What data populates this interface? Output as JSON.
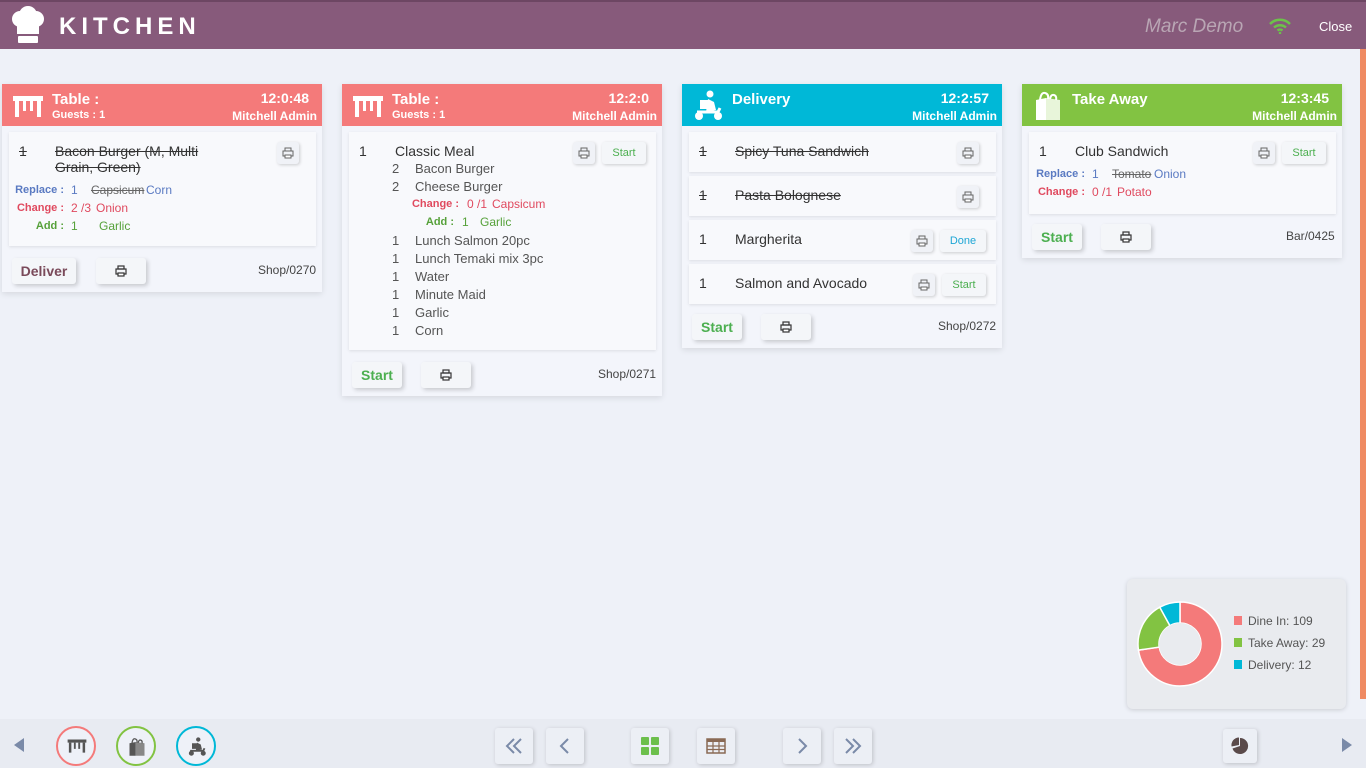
{
  "app": {
    "title": "KITCHEN",
    "user": "Marc Demo",
    "close_label": "Close"
  },
  "orders": [
    {
      "type": "Table :",
      "sub": "Guests : 1",
      "time": "12:0:48",
      "admin": "Mitchell Admin",
      "items": [
        {
          "qty": "1",
          "name": "Bacon Burger (M, Multi Grain, Green)",
          "done": true
        }
      ],
      "modifiers": [
        {
          "label": "Replace :",
          "qty": "1",
          "old": "Capsicum",
          "new": "Corn"
        },
        {
          "label": "Change :",
          "qty": "2 /3",
          "new": "Onion"
        },
        {
          "label": "Add :",
          "qty": "1",
          "new": "Garlic"
        }
      ],
      "action": "Deliver",
      "ref": "Shop/0270"
    },
    {
      "type": "Table :",
      "sub": "Guests : 1",
      "time": "12:2:0",
      "admin": "Mitchell Admin",
      "items": [
        {
          "qty": "1",
          "name": "Classic Meal",
          "button": "Start"
        }
      ],
      "sub_items": [
        {
          "qty": "2",
          "name": "Bacon Burger"
        },
        {
          "qty": "2",
          "name": "Cheese Burger"
        },
        {
          "qty": "1",
          "name": "Lunch Salmon 20pc"
        },
        {
          "qty": "1",
          "name": "Lunch Temaki mix 3pc"
        },
        {
          "qty": "1",
          "name": "Water"
        },
        {
          "qty": "1",
          "name": "Minute Maid"
        },
        {
          "qty": "1",
          "name": "Garlic"
        },
        {
          "qty": "1",
          "name": "Corn"
        }
      ],
      "modifiers": [
        {
          "label": "Change :",
          "qty": "0 /1",
          "new": "Capsicum"
        },
        {
          "label": "Add :",
          "qty": "1",
          "new": "Garlic"
        }
      ],
      "action": "Start",
      "ref": "Shop/0271"
    },
    {
      "type": "Delivery",
      "time": "12:2:57",
      "admin": "Mitchell Admin",
      "items": [
        {
          "qty": "1",
          "name": "Spicy Tuna Sandwich",
          "done": true
        },
        {
          "qty": "1",
          "name": "Pasta Bolognese",
          "done": true
        },
        {
          "qty": "1",
          "name": "Margherita",
          "button": "Done"
        },
        {
          "qty": "1",
          "name": "Salmon and Avocado",
          "button": "Start"
        }
      ],
      "action": "Start",
      "ref": "Shop/0272"
    },
    {
      "type": "Take Away",
      "time": "12:3:45",
      "admin": "Mitchell Admin",
      "items": [
        {
          "qty": "1",
          "name": "Club Sandwich",
          "button": "Start"
        }
      ],
      "modifiers": [
        {
          "label": "Replace :",
          "qty": "1",
          "old": "Tomato",
          "new": "Onion"
        },
        {
          "label": "Change :",
          "qty": "0 /1",
          "new": "Potato"
        }
      ],
      "action": "Start",
      "ref": "Bar/0425"
    }
  ],
  "stats": {
    "legend": [
      "Dine In: 109",
      "Take Away: 29",
      "Delivery: 12"
    ],
    "colors": {
      "dine_in": "#f47a7a",
      "take_away": "#82c342",
      "delivery": "#00b8d7"
    }
  },
  "chart_data": {
    "type": "pie",
    "categories": [
      "Dine In",
      "Take Away",
      "Delivery"
    ],
    "values": [
      109,
      29,
      12
    ]
  },
  "colors": {
    "header": "#875a7b",
    "table": "#f47a7a",
    "delivery": "#00b8d7",
    "take_away": "#82c342",
    "start": "#4caf50",
    "done": "#1ea6d5"
  },
  "icons": [
    "chef-hat-icon",
    "wifi-icon",
    "table-icon",
    "scooter-icon",
    "bag-icon",
    "print-icon",
    "pie-icon",
    "grid-icon",
    "table-grid-icon"
  ]
}
